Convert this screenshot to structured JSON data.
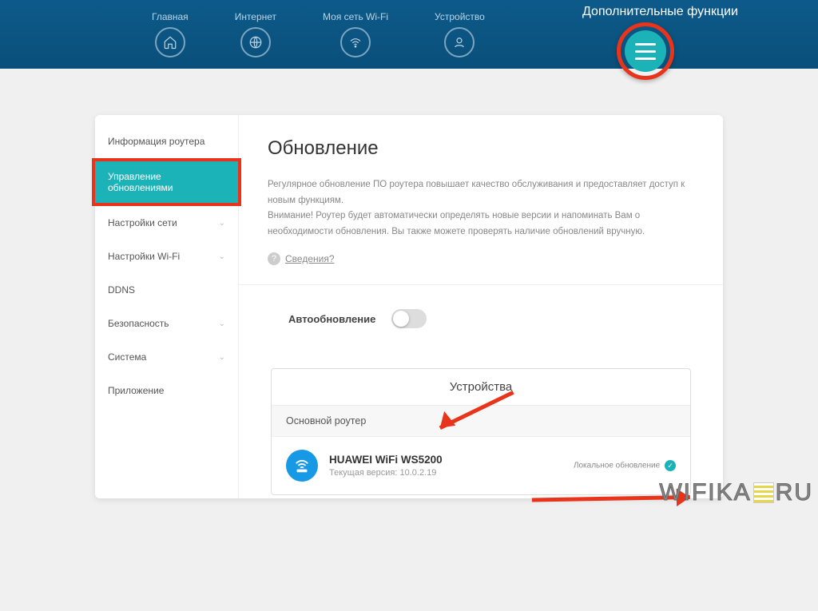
{
  "topnav": {
    "items": [
      {
        "label": "Главная"
      },
      {
        "label": "Интернет"
      },
      {
        "label": "Моя сеть Wi-Fi"
      },
      {
        "label": "Устройство"
      }
    ],
    "extra_label": "Дополнительные функции"
  },
  "sidebar": {
    "items": [
      {
        "label": "Информация роутера",
        "expandable": false
      },
      {
        "label": "Управление обновлениями",
        "expandable": false
      },
      {
        "label": "Настройки сети",
        "expandable": true
      },
      {
        "label": "Настройки Wi-Fi",
        "expandable": true
      },
      {
        "label": "DDNS",
        "expandable": false
      },
      {
        "label": "Безопасность",
        "expandable": true
      },
      {
        "label": "Система",
        "expandable": true
      },
      {
        "label": "Приложение",
        "expandable": false
      }
    ],
    "active_index": 1
  },
  "main": {
    "title": "Обновление",
    "desc1": "Регулярное обновление ПО роутера повышает качество обслуживания и предоставляет доступ к новым функциям.",
    "desc2": "Внимание! Роутер будет автоматически определять новые версии и напоминать Вам о необходимости обновления. Вы также можете проверять наличие обновлений вручную.",
    "details_link": "Сведения?",
    "auto_update_label": "Автообновление",
    "auto_update_on": false
  },
  "devices": {
    "panel_title": "Устройства",
    "subheader": "Основной роутер",
    "device": {
      "name": "HUAWEI WiFi WS5200",
      "version_label": "Текущая версия:",
      "version": "10.0.2.19"
    },
    "local_update_label": "Локальное обновление"
  },
  "watermark": {
    "pre": "WIFIKA",
    "post": "RU"
  }
}
